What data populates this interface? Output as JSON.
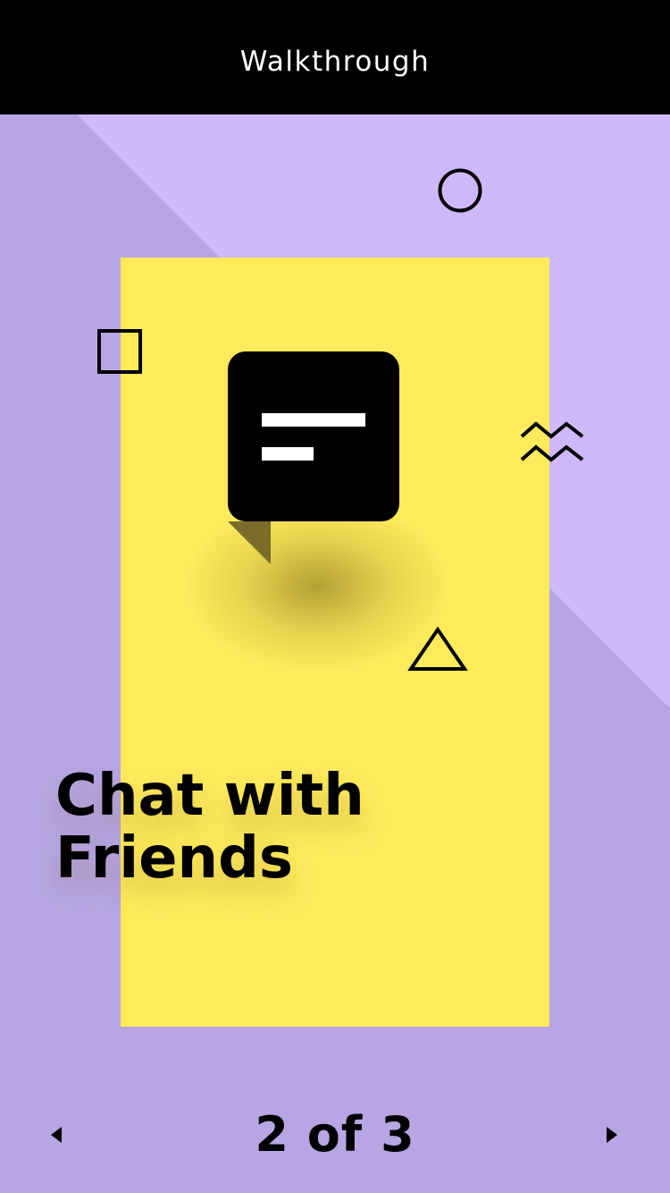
{
  "header": {
    "title": "Walkthrough"
  },
  "slide": {
    "headline_line1": "Chat with",
    "headline_line2": "Friends"
  },
  "pager": {
    "text": "2 of 3",
    "prev_icon": "triangle-left-icon",
    "next_icon": "triangle-right-icon"
  },
  "colors": {
    "header_bg": "#000000",
    "background_dark": "#b7a6e3",
    "background_light": "#cfb9fc",
    "card": "#ffea5c",
    "ink": "#000000"
  },
  "icons": [
    "chat-bubble-icon",
    "circle-icon",
    "square-icon",
    "zigzag-icon",
    "triangle-icon"
  ]
}
